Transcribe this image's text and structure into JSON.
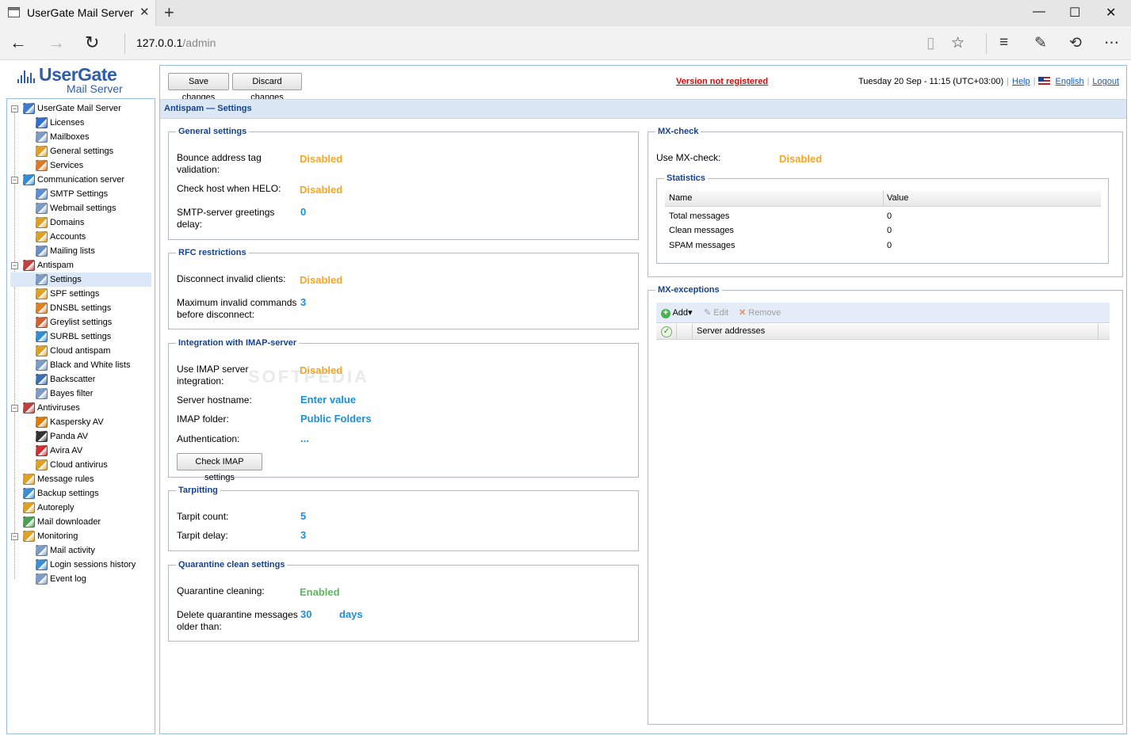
{
  "browser": {
    "tab_title": "UserGate Mail Server",
    "new_tab": "+",
    "url_host": "127.0.0.1",
    "url_path": "/admin",
    "window": {
      "minimize": "—",
      "maximize": "☐",
      "close": "✕"
    }
  },
  "app": {
    "logo_brand": "UserGate",
    "logo_sub": "Mail Server",
    "save_label": "Save changes",
    "discard_label": "Discard changes",
    "version_text": "Version not registered",
    "datetime": "Tuesday 20 Sep - 11:15 (UTC+03:00)",
    "help": "Help",
    "language": "English",
    "logout": "Logout"
  },
  "sidebar": {
    "items": [
      {
        "label": "UserGate Mail Server",
        "icon": "server-icon",
        "color": "#3a7bd5"
      },
      {
        "label": "Licenses",
        "icon": "info-icon",
        "color": "#2f6fd0"
      },
      {
        "label": "Mailboxes",
        "icon": "mailbox-icon",
        "color": "#7a9cc6"
      },
      {
        "label": "General settings",
        "icon": "settings-icon",
        "color": "#e0a020"
      },
      {
        "label": "Services",
        "icon": "services-icon",
        "color": "#e07a20"
      },
      {
        "label": "Communication server",
        "icon": "at-icon",
        "color": "#2f8fd6"
      },
      {
        "label": "SMTP Settings",
        "icon": "smtp-icon",
        "color": "#5a8fd6"
      },
      {
        "label": "Webmail settings",
        "icon": "webmail-icon",
        "color": "#7a9cc6"
      },
      {
        "label": "Domains",
        "icon": "domains-icon",
        "color": "#e0a020"
      },
      {
        "label": "Accounts",
        "icon": "accounts-icon",
        "color": "#e0a020"
      },
      {
        "label": "Mailing lists",
        "icon": "mailing-lists-icon",
        "color": "#6a8fc6"
      },
      {
        "label": "Antispam",
        "icon": "antispam-icon",
        "color": "#c04040"
      },
      {
        "label": "Settings",
        "icon": "antispam-settings-icon",
        "color": "#7a9cc6"
      },
      {
        "label": "SPF settings",
        "icon": "spf-icon",
        "color": "#e0a020"
      },
      {
        "label": "DNSBL settings",
        "icon": "dnsbl-icon",
        "color": "#e08020"
      },
      {
        "label": "Greylist settings",
        "icon": "greylist-icon",
        "color": "#d06030"
      },
      {
        "label": "SURBL settings",
        "icon": "surbl-icon",
        "color": "#2f8fd6"
      },
      {
        "label": "Cloud antispam",
        "icon": "cloud-antispam-icon",
        "color": "#e0a020"
      },
      {
        "label": "Black and White lists",
        "icon": "black-white-lists-icon",
        "color": "#7a9cc6"
      },
      {
        "label": "Backscatter",
        "icon": "backscatter-icon",
        "color": "#3a6fb5"
      },
      {
        "label": "Bayes filter",
        "icon": "bayes-filter-icon",
        "color": "#7a9cc6"
      },
      {
        "label": "Antiviruses",
        "icon": "antiviruses-icon",
        "color": "#c04040"
      },
      {
        "label": "Kaspersky AV",
        "icon": "kaspersky-icon",
        "color": "#e07a00"
      },
      {
        "label": "Panda AV",
        "icon": "panda-icon",
        "color": "#333333"
      },
      {
        "label": "Avira AV",
        "icon": "avira-icon",
        "color": "#d03030"
      },
      {
        "label": "Cloud antivirus",
        "icon": "cloud-antivirus-icon",
        "color": "#e0a020"
      },
      {
        "label": "Message rules",
        "icon": "message-rules-icon",
        "color": "#e0a020"
      },
      {
        "label": "Backup settings",
        "icon": "backup-icon",
        "color": "#3a8fd6"
      },
      {
        "label": "Autoreply",
        "icon": "autoreply-icon",
        "color": "#e0a020"
      },
      {
        "label": "Mail downloader",
        "icon": "mail-downloader-icon",
        "color": "#4a9f50"
      },
      {
        "label": "Monitoring",
        "icon": "monitoring-icon",
        "color": "#e0a020"
      },
      {
        "label": "Mail activity",
        "icon": "mail-activity-icon",
        "color": "#7a9cc6"
      },
      {
        "label": "Login sessions history",
        "icon": "login-history-icon",
        "color": "#3a8fd6"
      },
      {
        "label": "Event log",
        "icon": "event-log-icon",
        "color": "#7a9cc6"
      }
    ]
  },
  "section_title": "Antispam — Settings",
  "general": {
    "legend": "General settings",
    "bounce_label": "Bounce address tag validation:",
    "bounce_value": "Disabled",
    "helo_label": "Check host when HELO:",
    "helo_value": "Disabled",
    "delay_label": "SMTP-server greetings delay:",
    "delay_value": "0"
  },
  "rfc": {
    "legend": "RFC restrictions",
    "disconnect_label": "Disconnect invalid clients:",
    "disconnect_value": "Disabled",
    "max_label": "Maximum invalid commands before disconnect:",
    "max_value": "3"
  },
  "imap": {
    "legend": "Integration with IMAP-server",
    "use_label": "Use IMAP server integration:",
    "use_value": "Disabled",
    "host_label": "Server hostname:",
    "host_value": "Enter value",
    "folder_label": "IMAP folder:",
    "folder_value": "Public Folders",
    "auth_label": "Authentication:",
    "auth_value": "...",
    "check_label": "Check IMAP settings"
  },
  "tarpit": {
    "legend": "Tarpitting",
    "count_label": "Tarpit count:",
    "count_value": "5",
    "delay_label": "Tarpit delay:",
    "delay_value": "3"
  },
  "quarantine": {
    "legend": "Quarantine clean settings",
    "cleaning_label": "Quarantine cleaning:",
    "cleaning_value": "Enabled",
    "delete_label": "Delete quarantine messages older than:",
    "delete_value": "30",
    "delete_unit": "days"
  },
  "mxcheck": {
    "legend": "MX-check",
    "use_label": "Use MX-check:",
    "use_value": "Disabled",
    "stats_legend": "Statistics",
    "col_name": "Name",
    "col_value": "Value",
    "rows": [
      {
        "name": "Total messages",
        "value": "0"
      },
      {
        "name": "Clean messages",
        "value": "0"
      },
      {
        "name": "SPAM messages",
        "value": "0"
      }
    ]
  },
  "mxexceptions": {
    "legend": "MX-exceptions",
    "add": "Add",
    "edit": "Edit",
    "remove": "Remove",
    "col_servers": "Server addresses"
  },
  "watermark": "SOFTPEDIA",
  "colors": {
    "disabled": "#f5a623",
    "value_blue": "#1d8fd6",
    "enabled": "#5cb85c",
    "legend": "#15428b",
    "alert": "#e00000"
  }
}
